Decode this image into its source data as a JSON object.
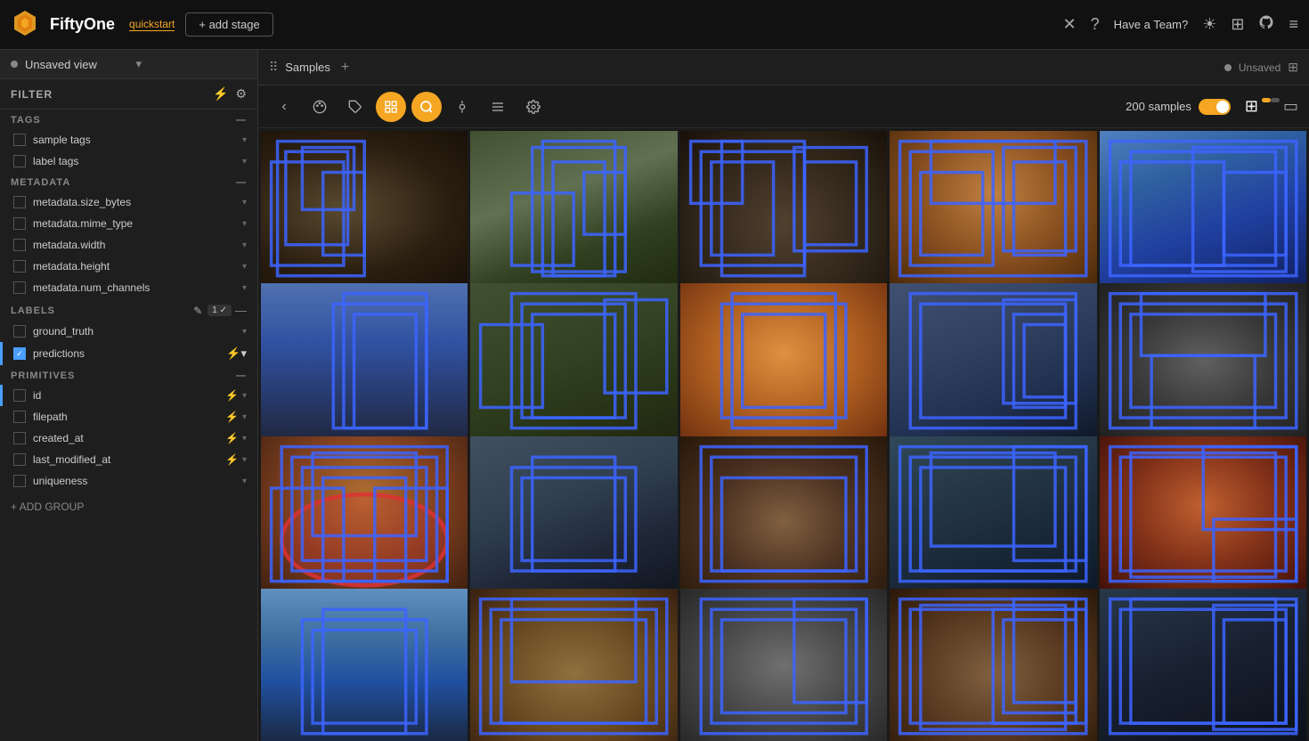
{
  "app": {
    "name": "FiftyOne",
    "subtitle": "quickstart",
    "add_stage_label": "+ add stage",
    "have_a_team": "Have a Team?"
  },
  "sidebar": {
    "unsaved_view": "Unsaved view",
    "filter_label": "FILTER",
    "sections": {
      "tags": {
        "label": "TAGS",
        "items": [
          {
            "id": "sample-tags",
            "label": "sample tags",
            "checked": false
          },
          {
            "id": "label-tags",
            "label": "label tags",
            "checked": false
          }
        ]
      },
      "metadata": {
        "label": "METADATA",
        "items": [
          {
            "id": "size-bytes",
            "label": "metadata.size_bytes",
            "checked": false
          },
          {
            "id": "mime-type",
            "label": "metadata.mime_type",
            "checked": false
          },
          {
            "id": "width",
            "label": "metadata.width",
            "checked": false
          },
          {
            "id": "height",
            "label": "metadata.height",
            "checked": false
          },
          {
            "id": "num-channels",
            "label": "metadata.num_channels",
            "checked": false
          }
        ]
      },
      "labels": {
        "label": "LABELS",
        "badge": "1 ✓",
        "items": [
          {
            "id": "ground-truth",
            "label": "ground_truth",
            "checked": false,
            "active": false
          },
          {
            "id": "predictions",
            "label": "predictions",
            "checked": true,
            "active": true,
            "lightning": true
          }
        ]
      },
      "primitives": {
        "label": "PRIMITIVES",
        "items": [
          {
            "id": "id",
            "label": "id",
            "checked": false,
            "lightning": true
          },
          {
            "id": "filepath",
            "label": "filepath",
            "checked": false,
            "lightning": true
          },
          {
            "id": "created-at",
            "label": "created_at",
            "checked": false,
            "lightning": true
          },
          {
            "id": "last-modified",
            "label": "last_modified_at",
            "checked": false,
            "lightning": true
          },
          {
            "id": "uniqueness",
            "label": "uniqueness",
            "checked": false
          }
        ]
      }
    },
    "add_group": "+ ADD GROUP"
  },
  "tabs": {
    "samples_tab": "Samples",
    "unsaved_label": "Unsaved"
  },
  "toolbar": {
    "sample_count": "200 samples",
    "back_tooltip": "Back",
    "color_tooltip": "Color",
    "tag_tooltip": "Tag",
    "select_tooltip": "Select",
    "search_tooltip": "Search",
    "match_tooltip": "Match",
    "list_tooltip": "List",
    "settings_tooltip": "Settings"
  },
  "grid": {
    "images": [
      {
        "id": 1,
        "color": "#3a2e1e",
        "gradient": "radial-gradient(ellipse at 40% 50%, #5a4a30 0%, #2a1e10 60%, #1a1008 100%)"
      },
      {
        "id": 2,
        "color": "#4a5a30",
        "gradient": "linear-gradient(160deg, #506030 0%, #607040 30%, #304020 70%, #202a10 100%)"
      },
      {
        "id": 3,
        "color": "#3a3020",
        "gradient": "radial-gradient(ellipse at 50% 60%, #504030 0%, #2a2015 70%, #181008 100%)"
      },
      {
        "id": 4,
        "color": "#7a5020",
        "gradient": "radial-gradient(ellipse at 50% 40%, #c08040 0%, #8a5020 50%, #4a2808 100%)"
      },
      {
        "id": 5,
        "color": "#2040a0",
        "gradient": "radial-gradient(ellipse at 50% 50%, #4080c0 0%, #2050a0 40%, #102060 100%)"
      },
      {
        "id": 6,
        "color": "#3050a0",
        "gradient": "linear-gradient(180deg, #4060b0 0%, #202840 100%)"
      },
      {
        "id": 7,
        "color": "#304020",
        "gradient": "linear-gradient(160deg, #405030 0%, #303820 50%, #202810 100%)"
      },
      {
        "id": 8,
        "color": "#c07030",
        "gradient": "radial-gradient(ellipse at 50% 45%, #e09040 0%, #b06020 50%, #703010 100%)"
      },
      {
        "id": 9,
        "color": "#304060",
        "gradient": "linear-gradient(160deg, #405070 0%, #203050 50%, #101828 100%)"
      },
      {
        "id": 10,
        "color": "#404040",
        "gradient": "radial-gradient(ellipse at 50% 50%, #606060 0%, #383838 50%, #202020 100%)"
      },
      {
        "id": 11,
        "color": "#805020",
        "gradient": "radial-gradient(ellipse at 50% 40%, #b07030 0%, #804020 50%, #402010 100%)"
      },
      {
        "id": 12,
        "color": "#405060",
        "gradient": "radial-gradient(ellipse at 50% 50%, #607080 0%, #304050 50%, #182028 100%)"
      },
      {
        "id": 13,
        "color": "#4a3020",
        "gradient": "radial-gradient(ellipse at 50% 55%, #806040 0%, #4a3020 50%, #281808 100%)"
      },
      {
        "id": 14,
        "color": "#203040",
        "gradient": "linear-gradient(160deg, #304858 0%, #182838 50%, #0c1420 100%)"
      },
      {
        "id": 15,
        "color": "#703020",
        "gradient": "radial-gradient(ellipse at 50% 45%, #c06030 0%, #803018 50%, #401008 100%)"
      },
      {
        "id": 16,
        "color": "#4070a0",
        "gradient": "linear-gradient(180deg, #6090c0 0%, #304870 50%, #1a2840 100%)"
      },
      {
        "id": 17,
        "color": "#6a4a20",
        "gradient": "radial-gradient(ellipse at 50% 55%, #907040 0%, #6a4a20 50%, #382010 100%)"
      },
      {
        "id": 18,
        "color": "#505050",
        "gradient": "radial-gradient(ellipse at 50% 50%, #707070 0%, #484848 50%, #282828 100%)"
      },
      {
        "id": 19,
        "color": "#5a3a20",
        "gradient": "radial-gradient(ellipse at 50% 55%, #806040 0%, #5a3a20 50%, #2a1808 100%)"
      },
      {
        "id": 20,
        "color": "#182838",
        "gradient": "linear-gradient(160deg, #283848 0%, #182030 50%, #0c1018 100%)"
      }
    ]
  }
}
